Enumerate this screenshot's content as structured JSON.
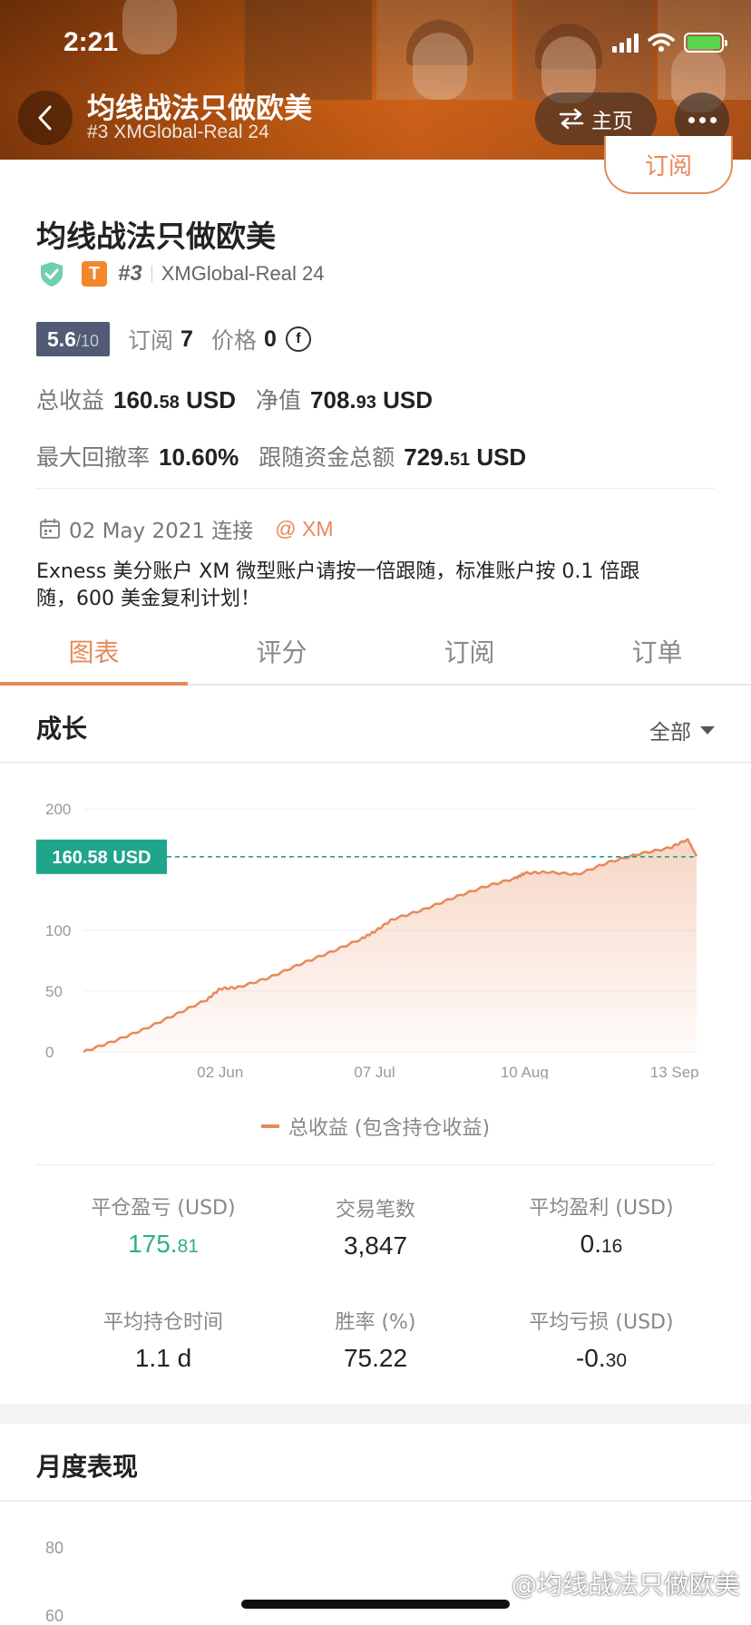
{
  "status_bar": {
    "time": "2:21"
  },
  "header": {
    "title": "均线战法只做欧美",
    "subtitle": "#3 XMGlobal-Real 24",
    "home_label": "主页"
  },
  "profile": {
    "subscribe_label": "订阅",
    "name": "均线战法只做欧美",
    "badge_letter": "T",
    "rank": "#3",
    "server": "XMGlobal-Real 24",
    "score_main": "5.6",
    "score_max": "/10",
    "subscriptions_label": "订阅",
    "subscriptions_value": "7",
    "price_label": "价格",
    "price_value": "0",
    "price_currency_symbol": "f",
    "total_profit_label": "总收益",
    "total_profit_int": "160.",
    "total_profit_dec": "58",
    "total_profit_unit": "USD",
    "equity_label": "净值",
    "equity_int": "708.",
    "equity_dec": "93",
    "equity_unit": "USD",
    "max_drawdown_label": "最大回撤率",
    "max_drawdown_value": "10.60%",
    "follow_funds_label": "跟随资金总额",
    "follow_funds_int": "729.",
    "follow_funds_dec": "51",
    "follow_funds_unit": "USD",
    "connect_text": "02 May 2021 连接",
    "broker_link": "@ XM",
    "description_line1": "Exness 美分账户 XM 微型账户请按一倍跟随，标准账户按 0.1 倍跟",
    "description_line2": "随，600 美金复利计划！"
  },
  "tabs": [
    {
      "label": "图表",
      "active": true
    },
    {
      "label": "评分",
      "active": false
    },
    {
      "label": "订阅",
      "active": false
    },
    {
      "label": "订单",
      "active": false
    }
  ],
  "growth_section": {
    "title": "成长",
    "range": "全部"
  },
  "chart_data": {
    "type": "area",
    "title": "",
    "current_value_label": "160.58 USD",
    "current_value": 160.58,
    "ylim": [
      0,
      200
    ],
    "yticks": [
      "0",
      "50",
      "100",
      "200"
    ],
    "xticks": [
      "02 Jun",
      "07 Jul",
      "10 Aug",
      "13 Sep"
    ],
    "series": [
      {
        "name": "总收益 (包含持仓收益)",
        "x": [
          "2021-05-02",
          "2021-05-09",
          "2021-05-16",
          "2021-05-23",
          "2021-05-30",
          "2021-06-02",
          "2021-06-06",
          "2021-06-13",
          "2021-06-20",
          "2021-06-27",
          "2021-07-04",
          "2021-07-07",
          "2021-07-11",
          "2021-07-18",
          "2021-07-25",
          "2021-08-01",
          "2021-08-08",
          "2021-08-10",
          "2021-08-15",
          "2021-08-22",
          "2021-08-29",
          "2021-09-05",
          "2021-09-12",
          "2021-09-16",
          "2021-09-18"
        ],
        "y": [
          0,
          9,
          19,
          31,
          43,
          52,
          53,
          61,
          72,
          82,
          93,
          99,
          109,
          117,
          127,
          136,
          143,
          147,
          148,
          146,
          156,
          163,
          168,
          175,
          161
        ]
      }
    ],
    "legend": "bottom",
    "line_color": "#e8895a",
    "label_color": "#1fa58a"
  },
  "stats": {
    "closed_pnl_label": "平仓盈亏 (USD)",
    "closed_pnl_int": "175.",
    "closed_pnl_dec": "81",
    "trades_label": "交易笔数",
    "trades_value": "3,847",
    "avg_profit_label": "平均盈利 (USD)",
    "avg_profit_int": "0.",
    "avg_profit_dec": "16",
    "avg_hold_label": "平均持仓时间",
    "avg_hold_value": "1.1 d",
    "win_rate_label": "胜率 (%)",
    "win_rate_value": "75.22",
    "avg_loss_label": "平均亏损 (USD)",
    "avg_loss_int": "-0.",
    "avg_loss_dec": "30"
  },
  "monthly_section": {
    "title": "月度表现",
    "ticks": [
      "80",
      "60"
    ]
  },
  "watermark": "@均线战法只做欧美",
  "colors": {
    "accent": "#e8895a",
    "green": "#2fae8c",
    "score_bg": "#525b75"
  }
}
